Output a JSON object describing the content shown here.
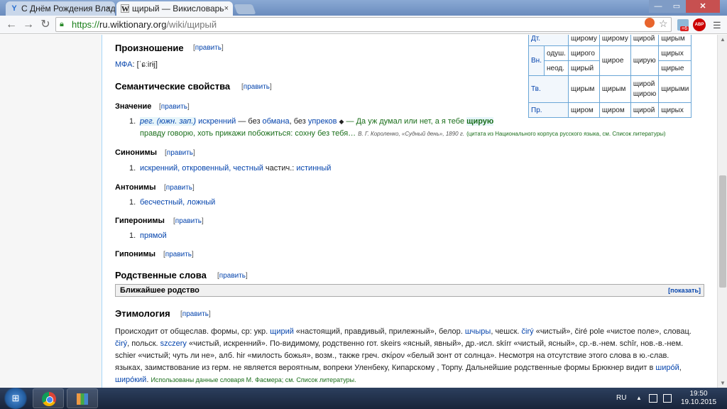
{
  "browser": {
    "tabs": [
      {
        "title": "С Днём Рождения Влади",
        "close": "×"
      },
      {
        "title": "щирый — Викисловарь",
        "close": "×"
      }
    ],
    "url_scheme": "https://",
    "url_host": "ru.wiktionary.org",
    "url_path": "/wiki/щирый",
    "window_controls": {
      "minimize": "—",
      "maximize": "▭",
      "close": "✕"
    },
    "ext_badge": "+6",
    "abp_label": "ABP"
  },
  "declension": {
    "rows": [
      {
        "case": "Дт.",
        "sub": "",
        "cells": [
          "щирому",
          "щирому",
          "щирой",
          "щирым"
        ]
      },
      {
        "case": "Вн.",
        "sub": "одуш.",
        "cells": [
          "щирого",
          "щирое",
          "щирую",
          "щирых"
        ]
      },
      {
        "case": "",
        "sub": "неод.",
        "cells": [
          "щирый",
          "",
          "",
          "щирые"
        ]
      },
      {
        "case": "Тв.",
        "sub": "",
        "cells": [
          "щирым",
          "щирым",
          "щирой щирою",
          "щирыми"
        ]
      },
      {
        "case": "Пр.",
        "sub": "",
        "cells": [
          "щиром",
          "щиром",
          "щирой",
          "щирых"
        ]
      }
    ]
  },
  "article": {
    "edit_label": "править",
    "pronunciation": {
      "heading": "Произношение",
      "ipa_label": "МФА",
      "ipa": ": [ˈɕːirɨj]"
    },
    "semantic": {
      "heading": "Семантические свойства"
    },
    "meaning": {
      "heading": "Значение",
      "number": "1.",
      "label": "рег. (южн. зап.)",
      "def_a": "искренний",
      "def_b": " — без ",
      "def_c": "обмана",
      "def_d": ", без ",
      "def_e": "упреков",
      "diamond": "◆",
      "quote_a": " — Да уж думал или нет, а я тебе ",
      "quote_bold": "щирую",
      "quote_b": "правду говорю, хоть прикажи побожиться: сохну без тебя…",
      "quote_src": "В. Г. Короленко, «Судный день», 1890 г.",
      "quote_note": "(цитата из Национального корпуса русского языка, см. Список литературы)"
    },
    "synonyms": {
      "heading": "Синонимы",
      "number": "1.",
      "items": "искренний, откровенный, честный",
      "extra": " частич.: ",
      "extra_link": "истинный"
    },
    "antonyms": {
      "heading": "Антонимы",
      "number": "1.",
      "items": "бесчестный, ложный"
    },
    "hypernyms": {
      "heading": "Гиперонимы",
      "number": "1.",
      "items": "прямой"
    },
    "hyponyms": {
      "heading": "Гипонимы"
    },
    "related": {
      "heading": "Родственные слова",
      "box_title": "Ближайшее родство",
      "show": "[показать]"
    },
    "etymology": {
      "heading": "Этимология",
      "line1_a": "Происходит от общеслав. формы, ср: укр. ",
      "line1_b": "щирий",
      "line1_c": " «настоящий, правдивый, прилежный», белор. ",
      "line1_d": "шчыры",
      "line1_e": ", чешск. ",
      "line1_f": "čirý",
      "line1_g": " «чистый», čiré pole «чистое поле», словац.",
      "line2_a": "čirý",
      "line2_b": ", польск. ",
      "line2_c": "szczery",
      "line2_d": " «чистый, искренний». По-видимому, родственно гот. skeirs «ясный, явный», др.-исл. skírr «чистый, ясный», ср.-в.-нем. schîr, нов.-в.-нем.",
      "line3": "schier «чистый; чуть ли не», алб. hir «милость божья», возм., также греч. σκίρον «белый зонт от солнца». Несмотря на отсутствие этого слова в ю.-слав.",
      "line4_a": "языках, заимствование из герм. не является вероятным, вопреки Уленбеку, Кипарскому , Торпу. Дальнейшие родственные формы Брюкнер видит в ",
      "line4_b": "широ́й",
      "line4_c": ",",
      "line5_a": "широ́кий",
      "line5_b": ". ",
      "line5_c": "Использованы данные словаря М. Фасмера; см. Список литературы."
    }
  },
  "taskbar": {
    "lang": "RU",
    "time": "19:50",
    "date": "19.10.2015",
    "up_arrow": "▲"
  }
}
